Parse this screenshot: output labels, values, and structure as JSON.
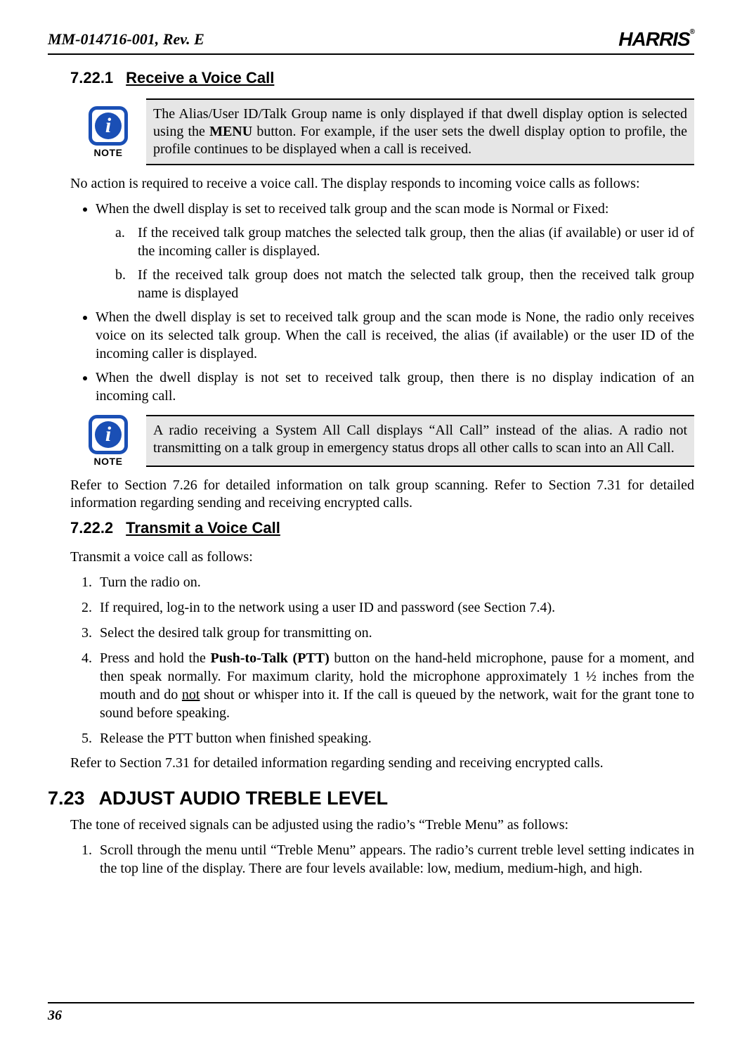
{
  "header": {
    "doc_id": "MM-014716-001, Rev. E",
    "brand": "HARRIS",
    "trademark": "®"
  },
  "s1": {
    "num": "7.22.1",
    "title": "Receive a Voice Call",
    "note1_label": "NOTE",
    "note1_pre": "The Alias/User ID/Talk Group name is only displayed if that dwell display option is selected using the ",
    "note1_bold": "MENU",
    "note1_post": " button. For example, if the user sets the dwell display option to profile, the profile continues to be displayed when a call is received.",
    "intro": "No action is required to receive a voice call. The display responds to incoming voice calls as follows:",
    "b1": "When the dwell display is set to received talk group and the scan mode is Normal or Fixed:",
    "b1a_m": "a.",
    "b1a": "If the received talk group matches the selected talk group, then the alias (if available) or user id of the incoming caller is displayed.",
    "b1b_m": "b.",
    "b1b": "If the received talk group does not match the selected talk group, then the received talk group name is displayed",
    "b2": "When the dwell display is set to received talk group and the scan mode is None, the radio only receives voice on its selected talk group. When the call is received, the alias (if available) or the user ID of the incoming caller is displayed.",
    "b3": "When the dwell display is not set to received talk group, then there is no display indication of an incoming call.",
    "note2_label": "NOTE",
    "note2": "A radio receiving a System All Call displays “All Call” instead of the alias. A radio not transmitting on a talk group in emergency status drops all other calls to scan into an All Call.",
    "refer": "Refer to Section 7.26 for detailed information on talk group scanning. Refer to Section 7.31 for detailed information regarding sending and receiving encrypted calls."
  },
  "s2": {
    "num": "7.22.2",
    "title": "Transmit a Voice Call",
    "intro": "Transmit a voice call as follows:",
    "i1": "Turn the radio on.",
    "i2": "If required, log-in to the network using a user ID and password (see Section 7.4).",
    "i3": "Select the desired talk group for transmitting on.",
    "i4_pre": "Press and hold the ",
    "i4_bold": "Push-to-Talk (PTT)",
    "i4_mid": " button on the hand-held microphone, pause for a moment, and then speak normally. For maximum clarity, hold the microphone approximately 1 ½ inches from the mouth and do ",
    "i4_under": "not",
    "i4_post": " shout or whisper into it. If the call is queued by the network, wait for the grant tone to sound before speaking.",
    "i5": "Release the PTT button when finished speaking.",
    "refer": "Refer to Section 7.31 for detailed information regarding sending and receiving encrypted calls."
  },
  "s3": {
    "num": "7.23",
    "title": "ADJUST AUDIO TREBLE LEVEL",
    "intro": "The tone of received signals can be adjusted using the radio’s “Treble Menu” as follows:",
    "i1": "Scroll through the menu until “Treble Menu” appears. The radio’s current treble level setting indicates in the top line of the display. There are four levels available: low, medium, medium-high, and high."
  },
  "footer": {
    "page": "36"
  }
}
